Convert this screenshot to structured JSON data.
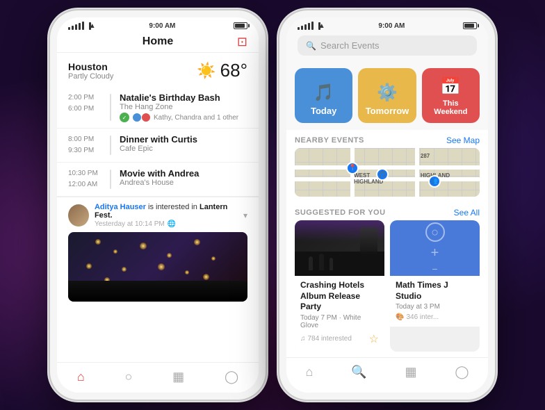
{
  "background": {
    "color": "#1a0a2e"
  },
  "phone1": {
    "status_bar": {
      "signal": "●●●●●",
      "wifi": "wifi",
      "time": "9:00 AM",
      "battery": "100"
    },
    "header": {
      "title": "Home",
      "icon": "📥"
    },
    "weather": {
      "location": "Houston",
      "condition": "Partly Cloudy",
      "icon": "☀️",
      "temp": "68°"
    },
    "events": [
      {
        "start": "2:00 PM",
        "end": "6:00 PM",
        "title": "Natalie's Birthday Bash",
        "venue": "The Hang Zone",
        "attendees": "Kathy, Chandra and 1 other"
      },
      {
        "start": "8:00 PM",
        "end": "9:30 PM",
        "title": "Dinner with Curtis",
        "venue": "Cafe Epic",
        "attendees": ""
      },
      {
        "start": "10:30 PM",
        "end": "12:00 AM",
        "title": "Movie with Andrea",
        "venue": "Andrea's House",
        "attendees": ""
      }
    ],
    "social": {
      "user": "Aditya Hauser",
      "action": "is interested in",
      "event": "Lantern Fest.",
      "meta": "Yesterday at 10:14 PM"
    },
    "nav": {
      "items": [
        "home",
        "search",
        "calendar",
        "profile"
      ]
    }
  },
  "phone2": {
    "status_bar": {
      "signal": "●●●●●",
      "wifi": "wifi",
      "time": "9:00 AM",
      "battery": "100"
    },
    "search": {
      "placeholder": "Search Events"
    },
    "tiles": [
      {
        "label": "Today",
        "color": "#4a90d9"
      },
      {
        "label": "Tomorrow",
        "color": "#e8b84b"
      },
      {
        "label": "This Weekend",
        "color": "#e05050"
      }
    ],
    "nearby": {
      "title": "NEARBY EVENTS",
      "link": "See Map"
    },
    "suggested": {
      "title": "SUGGESTED FOR YOU",
      "link": "See All",
      "cards": [
        {
          "title": "Crashing Hotels Album Release Party",
          "meta1": "Today 7 PM · White Glove",
          "genre": "Music",
          "interested": "784 interested"
        },
        {
          "title": "Math Times J Studio",
          "meta1": "Today at 3 PM",
          "genre": "Art",
          "interested": "346 inter..."
        }
      ]
    },
    "nav": {
      "items": [
        "home",
        "search",
        "calendar",
        "profile"
      ]
    }
  }
}
